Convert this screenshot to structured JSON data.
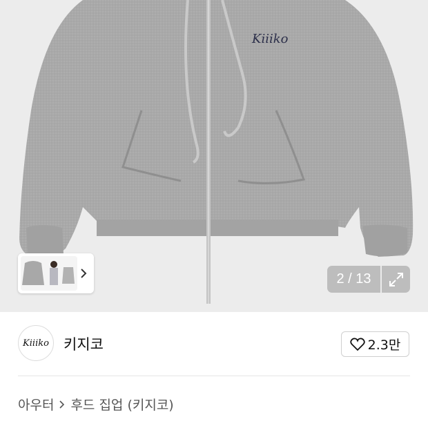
{
  "gallery": {
    "counter": "2 / 13",
    "thumbnail_next_icon": "chevron-right-icon",
    "expand_icon": "expand-icon",
    "logo_print": "Kiiiko"
  },
  "brand": {
    "name": "키지코",
    "logo_text": "Kiiiko",
    "like_icon": "heart-icon",
    "like_count": "2.3만"
  },
  "breadcrumb": {
    "category": "아우터",
    "separator_icon": "chevron-right-icon",
    "subcategory": "후드 집업 (키지코)"
  }
}
